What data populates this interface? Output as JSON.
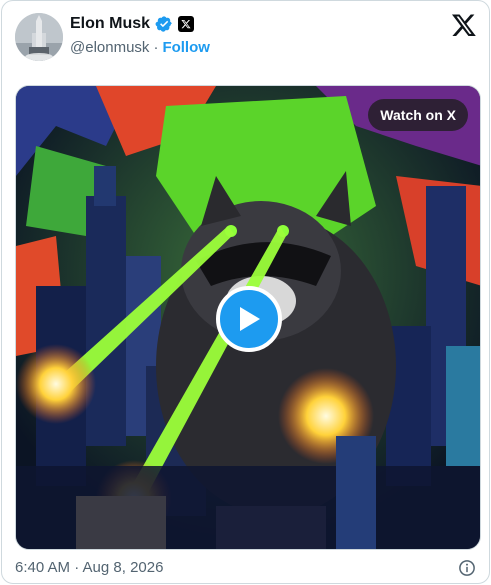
{
  "author": {
    "name": "Elon Musk",
    "handle": "@elonmusk",
    "separator": "·",
    "follow_label": "Follow",
    "verified_icon": "verified-badge-icon",
    "affiliation_icon": "x-affiliation-icon"
  },
  "header": {
    "logo_icon": "x-logo-icon"
  },
  "media": {
    "type": "video",
    "watch_label": "Watch on X",
    "play_icon": "play-icon"
  },
  "footer": {
    "timestamp": "6:40 AM · Aug 8, 2026",
    "info_icon": "info-icon"
  },
  "colors": {
    "accent": "#1d9bf0",
    "text": "#0f1419",
    "muted": "#536471",
    "border": "#cfd9de"
  }
}
